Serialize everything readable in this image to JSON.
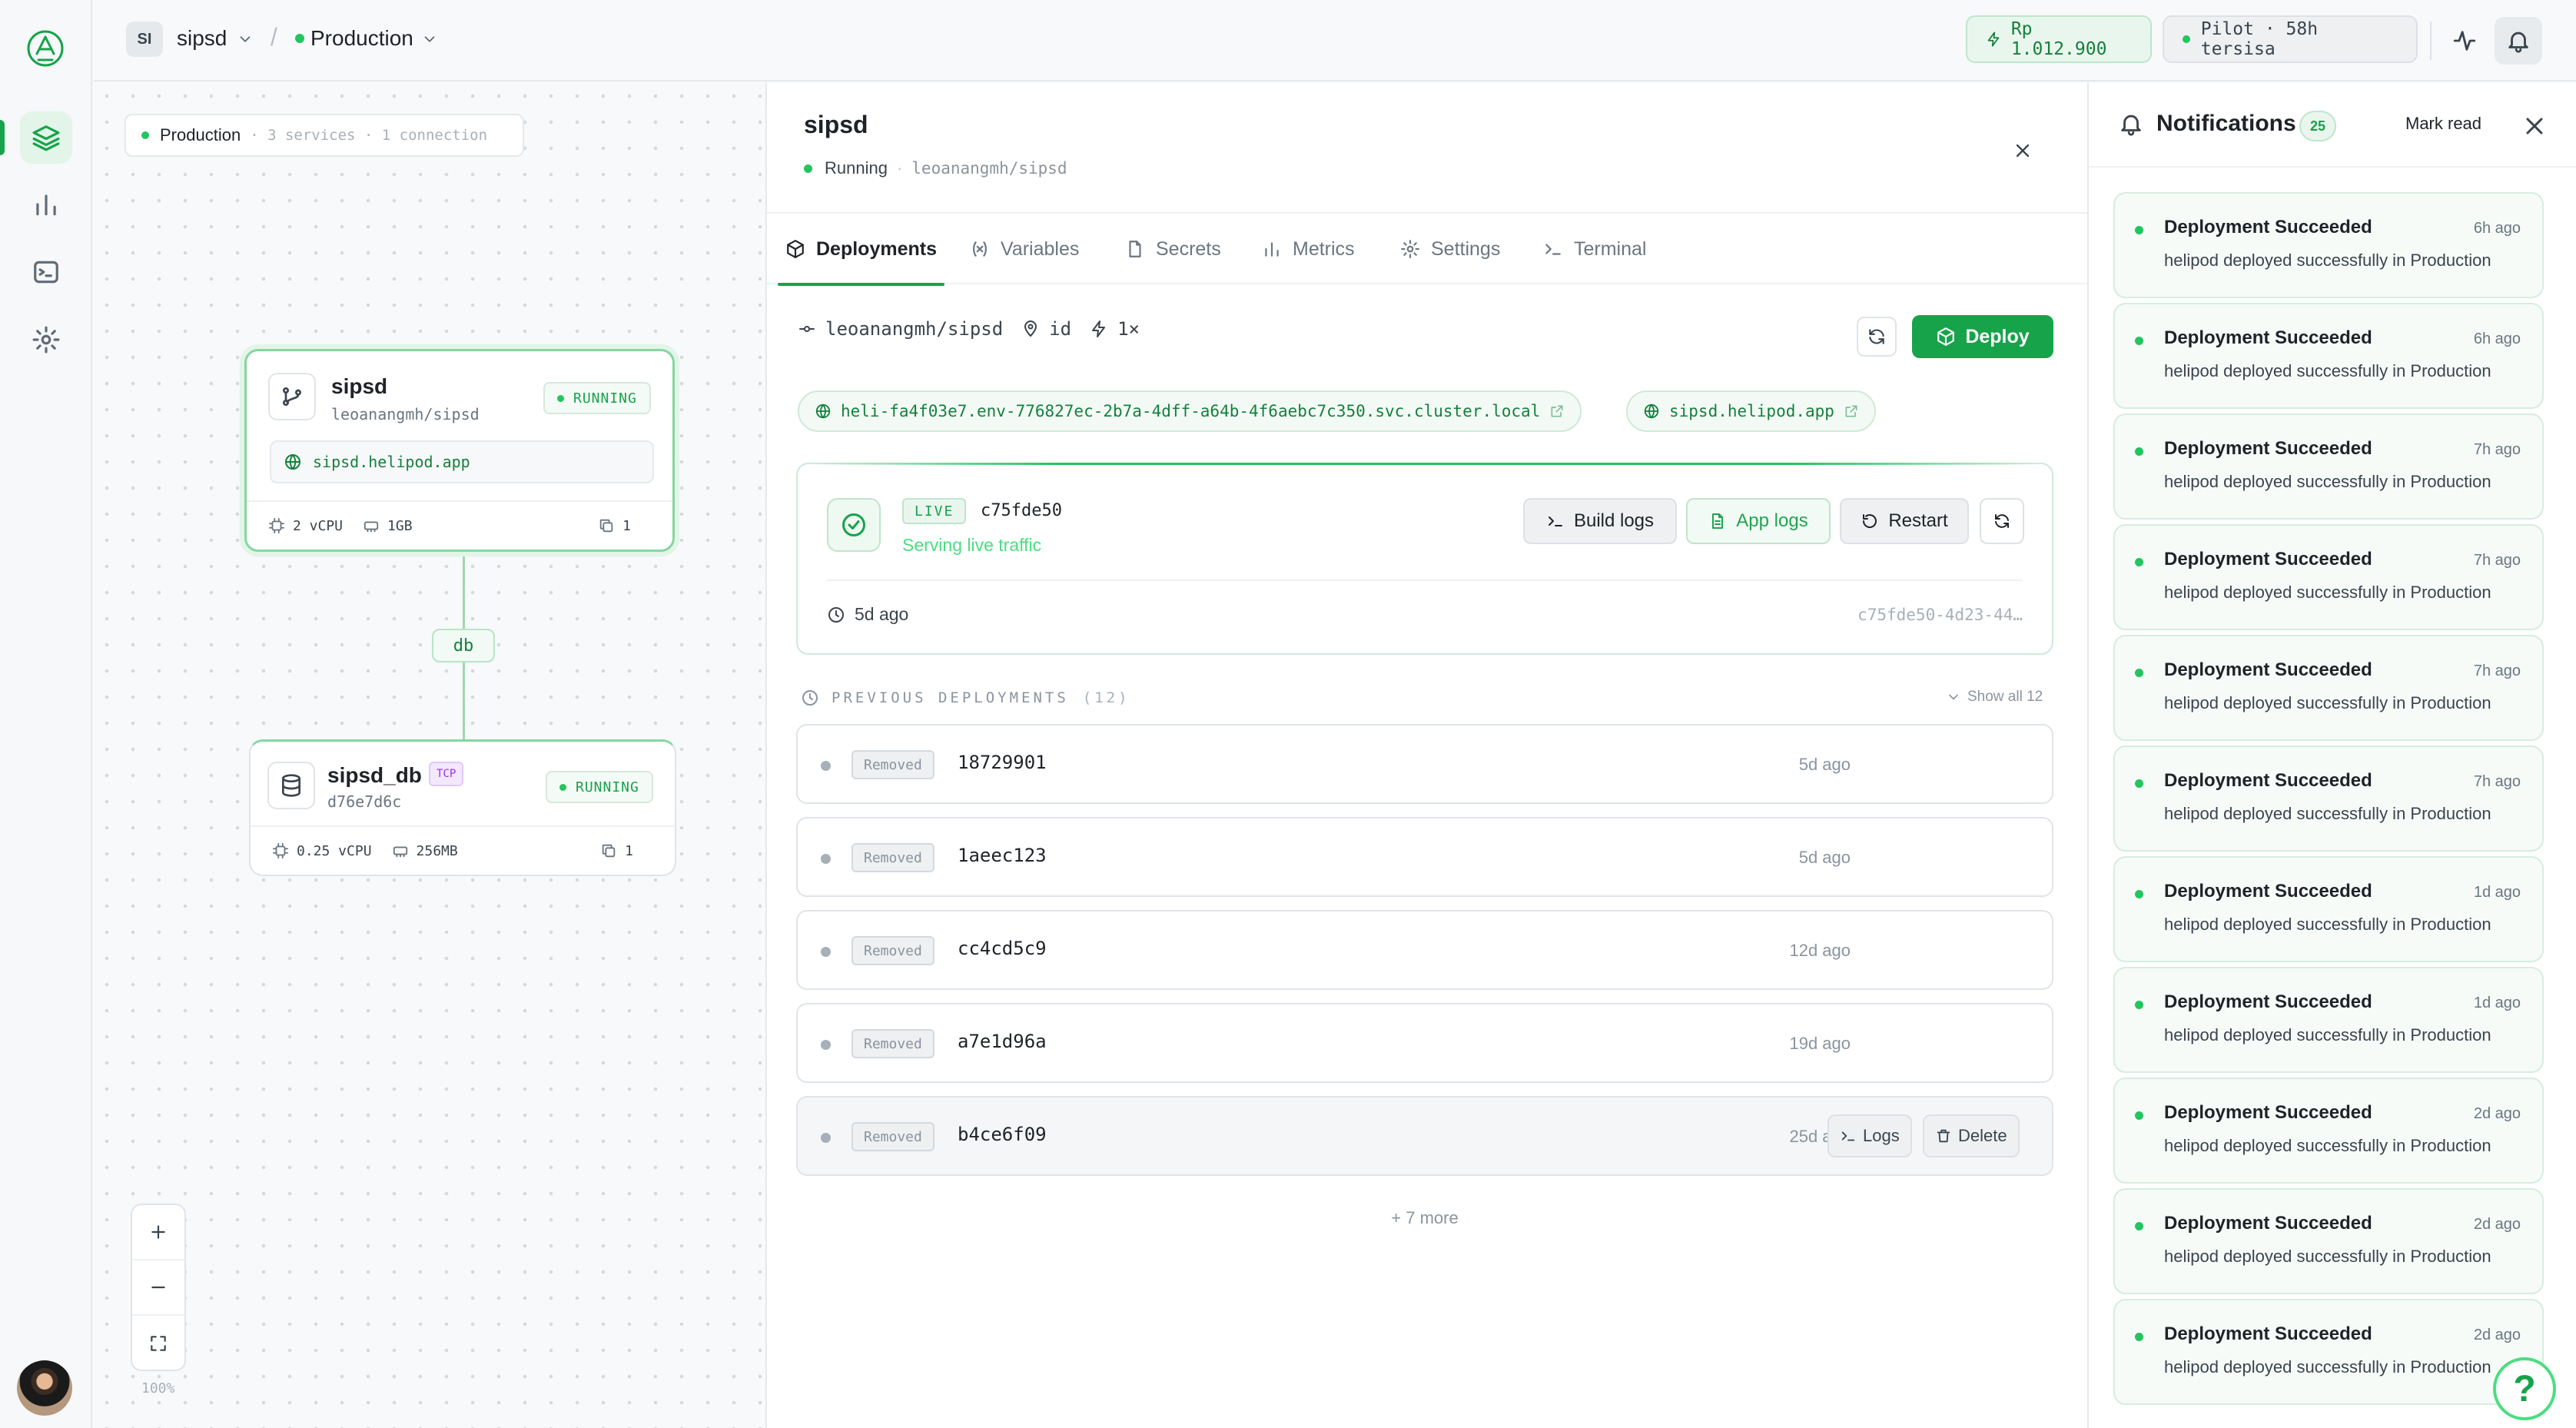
{
  "header": {
    "project_initials": "SI",
    "project_name": "sipsd",
    "separator": "/",
    "environment": "Production",
    "balance": "Rp 1.012.900",
    "plan": "Pilot · 58h tersisa"
  },
  "canvas": {
    "env_name": "Production",
    "env_meta": "· 3 services · 1 connection",
    "zoom_level": "100%",
    "services": [
      {
        "name": "sipsd",
        "sub": "leoanangmh/sipsd",
        "status": "RUNNING",
        "url": "sipsd.helipod.app",
        "cpu": "2 vCPU",
        "mem": "1GB",
        "replicas": "1"
      },
      {
        "name": "sipsd_db",
        "sub": "d76e7d6c",
        "tag": "TCP",
        "status": "RUNNING",
        "cpu": "0.25 vCPU",
        "mem": "256MB",
        "replicas": "1"
      }
    ],
    "connection_label": "db"
  },
  "detail": {
    "title": "sipsd",
    "status": "Running",
    "repo": "leoanangmh/sipsd",
    "tabs": [
      {
        "label": "Deployments"
      },
      {
        "label": "Variables"
      },
      {
        "label": "Secrets"
      },
      {
        "label": "Metrics"
      },
      {
        "label": "Settings"
      },
      {
        "label": "Terminal"
      }
    ],
    "source": {
      "repo": "leoanangmh/sipsd",
      "region": "id",
      "replicas": "1×"
    },
    "deploy_label": "Deploy",
    "urls": [
      "heli-fa4f03e7.env-776827ec-2b7a-4dff-a64b-4f6aebc7c350.svc.cluster.local",
      "sipsd.helipod.app"
    ],
    "live": {
      "badge": "LIVE",
      "sha": "c75fde50",
      "subtitle": "Serving live traffic",
      "time": "5d ago",
      "id": "c75fde50-4d23-44…",
      "build_logs": "Build logs",
      "app_logs": "App logs",
      "restart": "Restart"
    },
    "previous": {
      "heading": "PREVIOUS DEPLOYMENTS",
      "count": "(12)",
      "show_all": "Show all 12",
      "rows": [
        {
          "status": "Removed",
          "sha": "18729901",
          "time": "5d ago"
        },
        {
          "status": "Removed",
          "sha": "1aeec123",
          "time": "5d ago"
        },
        {
          "status": "Removed",
          "sha": "cc4cd5c9",
          "time": "12d ago"
        },
        {
          "status": "Removed",
          "sha": "a7e1d96a",
          "time": "19d ago"
        },
        {
          "status": "Removed",
          "sha": "b4ce6f09",
          "time": "25d ago",
          "logs": "Logs",
          "delete": "Delete"
        }
      ],
      "more": "+ 7 more"
    }
  },
  "notifications": {
    "title": "Notifications",
    "count": "25",
    "mark_read": "Mark read",
    "items": [
      {
        "title": "Deployment Succeeded",
        "time": "6h ago",
        "message": "helipod deployed successfully in Production"
      },
      {
        "title": "Deployment Succeeded",
        "time": "6h ago",
        "message": "helipod deployed successfully in Production"
      },
      {
        "title": "Deployment Succeeded",
        "time": "7h ago",
        "message": "helipod deployed successfully in Production"
      },
      {
        "title": "Deployment Succeeded",
        "time": "7h ago",
        "message": "helipod deployed successfully in Production"
      },
      {
        "title": "Deployment Succeeded",
        "time": "7h ago",
        "message": "helipod deployed successfully in Production"
      },
      {
        "title": "Deployment Succeeded",
        "time": "7h ago",
        "message": "helipod deployed successfully in Production"
      },
      {
        "title": "Deployment Succeeded",
        "time": "1d ago",
        "message": "helipod deployed successfully in Production"
      },
      {
        "title": "Deployment Succeeded",
        "time": "1d ago",
        "message": "helipod deployed successfully in Production"
      },
      {
        "title": "Deployment Succeeded",
        "time": "2d ago",
        "message": "helipod deployed successfully in Production"
      },
      {
        "title": "Deployment Succeeded",
        "time": "2d ago",
        "message": "helipod deployed successfully in Production"
      },
      {
        "title": "Deployment Succeeded",
        "time": "2d ago",
        "message": "helipod deployed successfully in Production"
      }
    ]
  },
  "help_label": "?",
  "colors": {
    "accent": "#16a34a",
    "live": "#22c55e",
    "removed": "#a7b0b8",
    "tcp": "#9333ea"
  }
}
